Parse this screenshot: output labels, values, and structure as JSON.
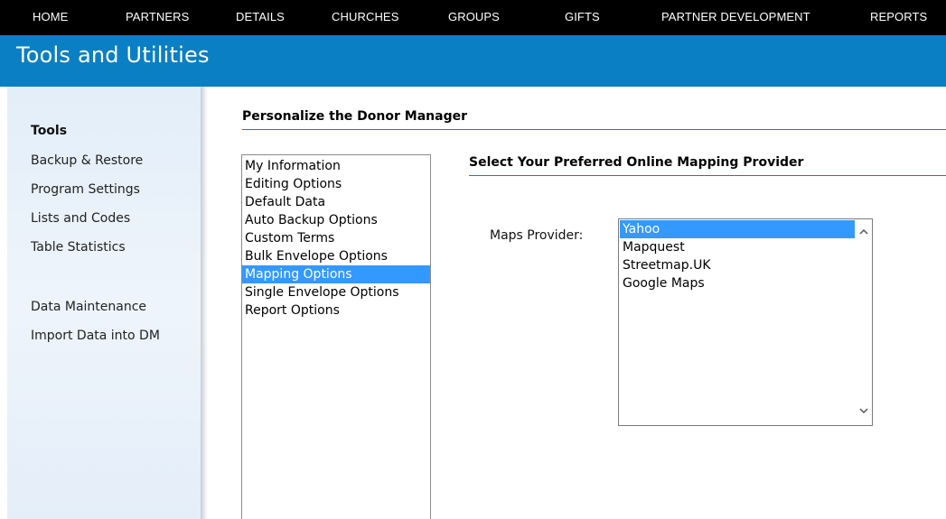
{
  "nav": {
    "items": [
      {
        "label": "HOME"
      },
      {
        "label": "PARTNERS"
      },
      {
        "label": "DETAILS"
      },
      {
        "label": "CHURCHES"
      },
      {
        "label": "GROUPS"
      },
      {
        "label": "GIFTS"
      },
      {
        "label": "PARTNER DEVELOPMENT"
      },
      {
        "label": "REPORTS"
      }
    ]
  },
  "banner": {
    "title": "Tools and Utilities"
  },
  "sidebar": {
    "heading": "Tools",
    "links": [
      {
        "label": "Backup & Restore"
      },
      {
        "label": "Program Settings"
      },
      {
        "label": "Lists and Codes"
      },
      {
        "label": "Table Statistics"
      },
      {
        "label": "Data Maintenance"
      },
      {
        "label": "Import Data into DM"
      }
    ]
  },
  "main": {
    "section_title": "Personalize the Donor Manager",
    "options": [
      {
        "label": "My Information"
      },
      {
        "label": "Editing Options"
      },
      {
        "label": "Default Data"
      },
      {
        "label": "Auto Backup Options"
      },
      {
        "label": "Custom Terms"
      },
      {
        "label": "Bulk Envelope Options"
      },
      {
        "label": "Mapping Options"
      },
      {
        "label": "Single Envelope Options"
      },
      {
        "label": "Report Options"
      }
    ],
    "selected_option": "Mapping Options",
    "mapping": {
      "title": "Select Your Preferred Online Mapping Provider",
      "field_label": "Maps Provider:",
      "providers": [
        {
          "label": "Yahoo"
        },
        {
          "label": "Mapquest"
        },
        {
          "label": "Streetmap.UK"
        },
        {
          "label": "Google Maps"
        }
      ],
      "selected_provider": "Yahoo"
    }
  },
  "colors": {
    "nav_bg": "#000000",
    "banner_bg": "#0b7fc3",
    "selection": "#3399ff",
    "sidebar_bg": "#e3eef9"
  }
}
